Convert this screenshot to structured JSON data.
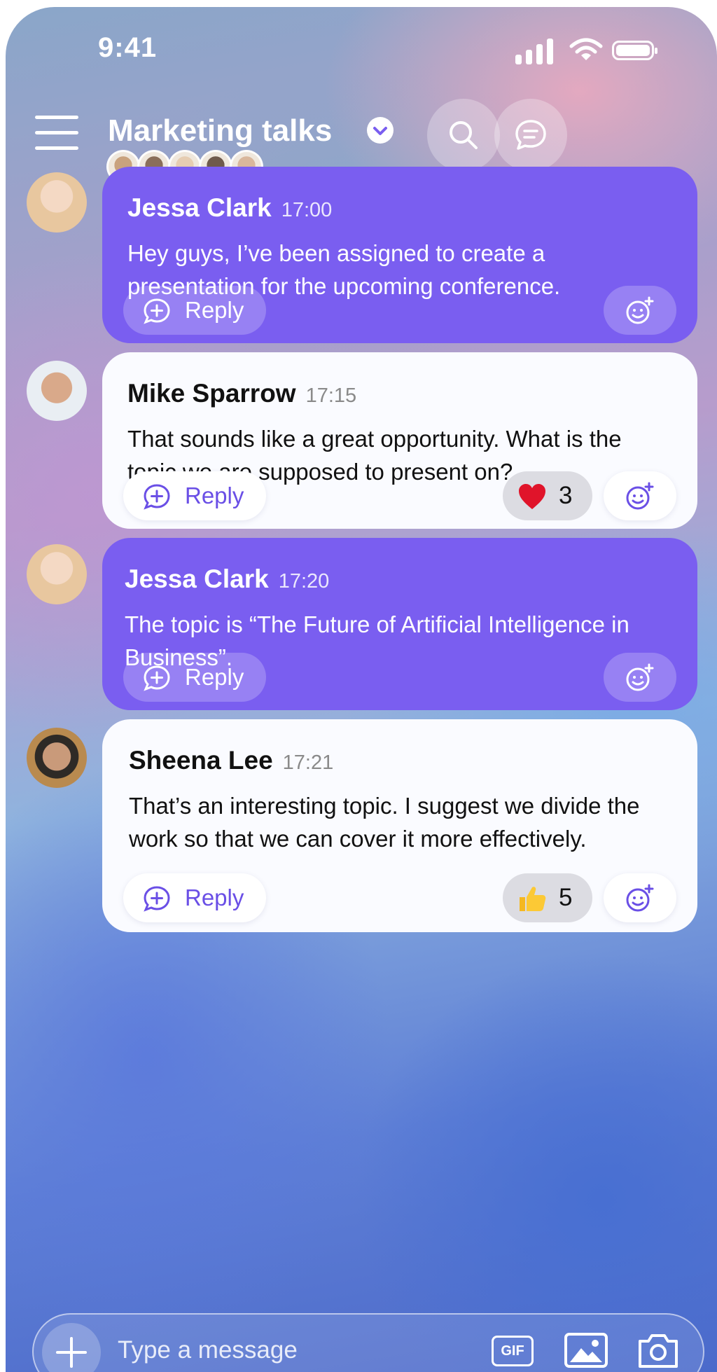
{
  "status_bar": {
    "time": "9:41"
  },
  "header": {
    "title": "Marketing talks",
    "members": [
      {
        "name": "member-1",
        "color": "#c9a27e"
      },
      {
        "name": "member-2",
        "color": "#8a6e5a"
      },
      {
        "name": "member-3",
        "color": "#e6cdb2"
      },
      {
        "name": "member-4",
        "color": "#6f5a4c"
      },
      {
        "name": "member-5",
        "color": "#d9b79c"
      }
    ]
  },
  "messages": [
    {
      "sender": "Jessa Clark",
      "time": "17:00",
      "text": "Hey guys, I’ve been assigned to create a presentation for the upcoming conference.",
      "reply": "Reply",
      "style": "purple"
    },
    {
      "sender": "Mike Sparrow",
      "time": "17:15",
      "text": "That sounds like a great opportunity. What is the topic we are supposed to present on?",
      "reply": "Reply",
      "style": "white",
      "reaction": {
        "icon": "heart-icon",
        "count": "3"
      }
    },
    {
      "sender": "Jessa Clark",
      "time": "17:20",
      "text": "The topic is “The Future of Artificial Intelligence in Business”.",
      "reply": "Reply",
      "style": "purple"
    },
    {
      "sender": "Sheena Lee",
      "time": "17:21",
      "text": "That’s an interesting topic. I suggest we divide the work so that we can cover it more effectively.",
      "reply": "Reply",
      "style": "white",
      "reaction": {
        "icon": "thumbs-up-icon",
        "count": "5"
      }
    }
  ],
  "composer": {
    "placeholder": "Type a message",
    "gif_label": "GIF"
  },
  "colors": {
    "accent": "#7a5ef0",
    "reply_text": "#6a4fe6"
  }
}
